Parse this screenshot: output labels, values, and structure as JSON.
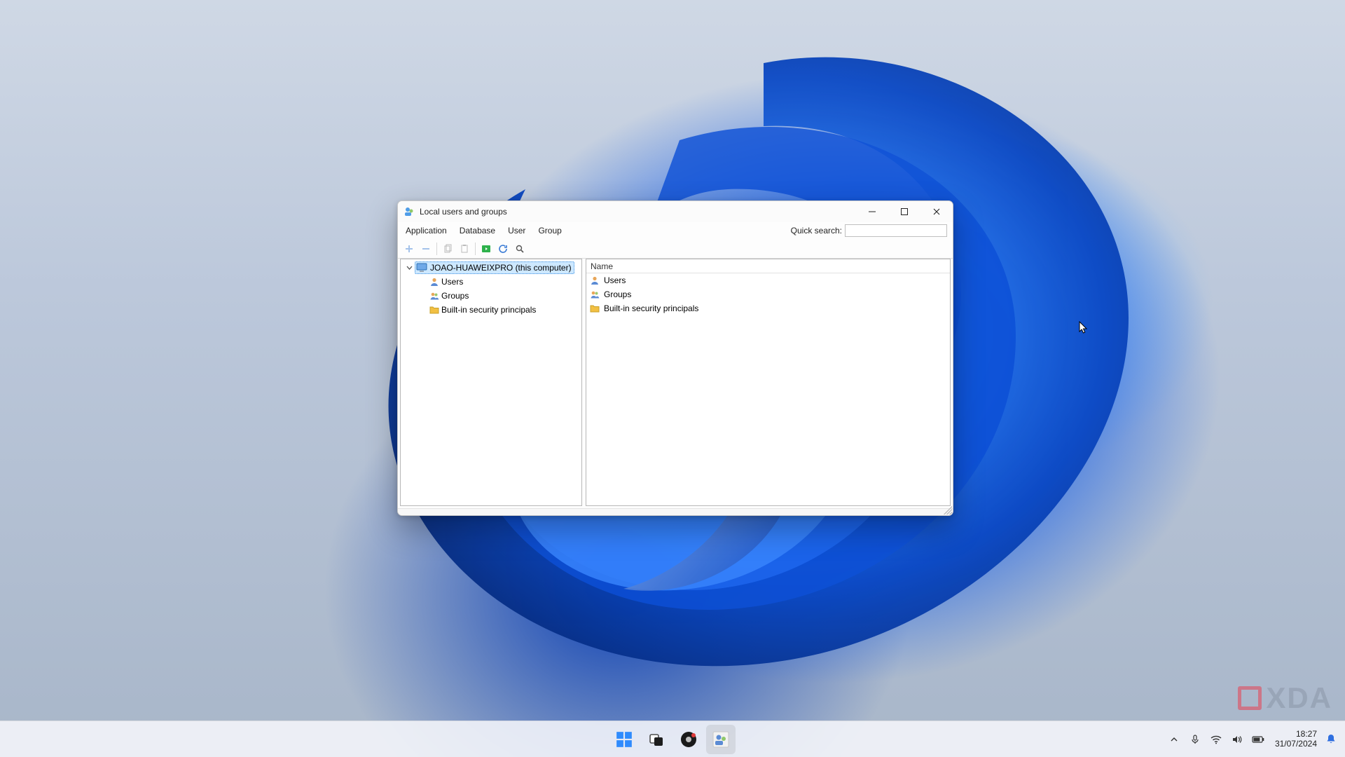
{
  "window": {
    "title": "Local users and groups",
    "menus": [
      "Application",
      "Database",
      "User",
      "Group"
    ],
    "quick_search_label": "Quick search:",
    "quick_search_value": ""
  },
  "tree": {
    "root_label": "JOAO-HUAWEIXPRO (this computer)",
    "children": [
      {
        "label": "Users",
        "icon": "user"
      },
      {
        "label": "Groups",
        "icon": "group"
      },
      {
        "label": "Built-in security principals",
        "icon": "folder"
      }
    ]
  },
  "list": {
    "columns": [
      "Name"
    ],
    "rows": [
      {
        "label": "Users",
        "icon": "user"
      },
      {
        "label": "Groups",
        "icon": "group"
      },
      {
        "label": "Built-in security principals",
        "icon": "folder"
      }
    ]
  },
  "taskbar": {
    "time": "18:27",
    "date": "31/07/2024"
  },
  "watermark": "XDA"
}
